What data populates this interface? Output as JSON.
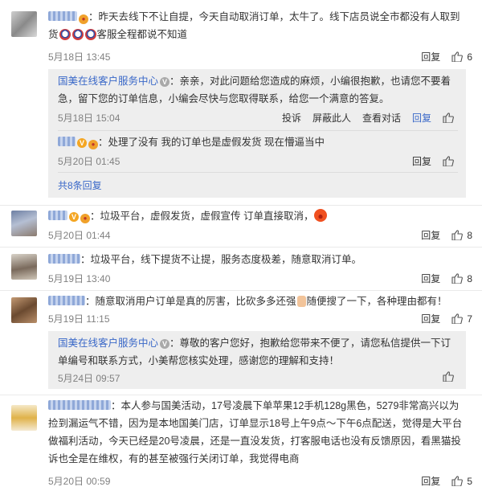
{
  "comments": [
    {
      "text": "：昨天去线下不让自提，今天自动取消订单，太牛了。线下店员说全市都没有人取到货",
      "text2": "客服全程都说不知道",
      "time": "5月18日 13:45",
      "reply_label": "回复",
      "likes": "6",
      "replies": [
        {
          "author": "国美在线客户服务中心",
          "text": "：亲亲，对此问题给您造成的麻烦，小编很抱歉，也请您不要着急，留下您的订单信息，小编会尽快与您取得联系，给您一个满意的答复。",
          "time": "5月18日 15:04",
          "actions": [
            "投诉",
            "屏蔽此人",
            "查看对话",
            "回复"
          ]
        },
        {
          "text": "：处理了没有 我的订单也是虚假发货 现在懵逼当中",
          "time": "5月20日 01:45",
          "actions": [
            "回复"
          ]
        }
      ],
      "more": "共8条回复"
    },
    {
      "text": "：垃圾平台，虚假发货，虚假宣传 订单直接取消，",
      "time": "5月20日 01:44",
      "reply_label": "回复",
      "likes": "8"
    },
    {
      "text": "：垃圾平台，线下提货不让提，服务态度极差，随意取消订单。",
      "time": "5月19日 13:40",
      "reply_label": "回复",
      "likes": "8"
    },
    {
      "text": "：随意取消用户订单是真的厉害，比砍多多还强",
      "text2": "随便搜了一下，各种理由都有！",
      "time": "5月19日 11:15",
      "reply_label": "回复",
      "likes": "7",
      "replies": [
        {
          "author": "国美在线客户服务中心",
          "text": "：尊敬的客户您好，抱歉给您带来不便了，请您私信提供一下订单编号和联系方式，小美帮您核实处理，感谢您的理解和支持！",
          "time": "5月24日 09:57",
          "actions": []
        }
      ]
    },
    {
      "text": "：本人参与国美活动，17号凌晨下单苹果12手机128g黑色，5279非常高兴以为捡到漏运气不错，因为是本地国美门店，订单显示18号上午9点～下午6点配送，觉得是大平台做福利活动，今天已经是20号凌晨，还是一直没发货，打客服电话也没有反馈原因，看黑猫投诉也全是在维权，有的甚至被强行关闭订单，我觉得电商",
      "time": "5月20日 00:59",
      "reply_label": "回复",
      "likes": "5"
    }
  ],
  "colors": {
    "link": "#3a68c8",
    "reply_bg": "#eeeeee",
    "time": "#808080"
  }
}
